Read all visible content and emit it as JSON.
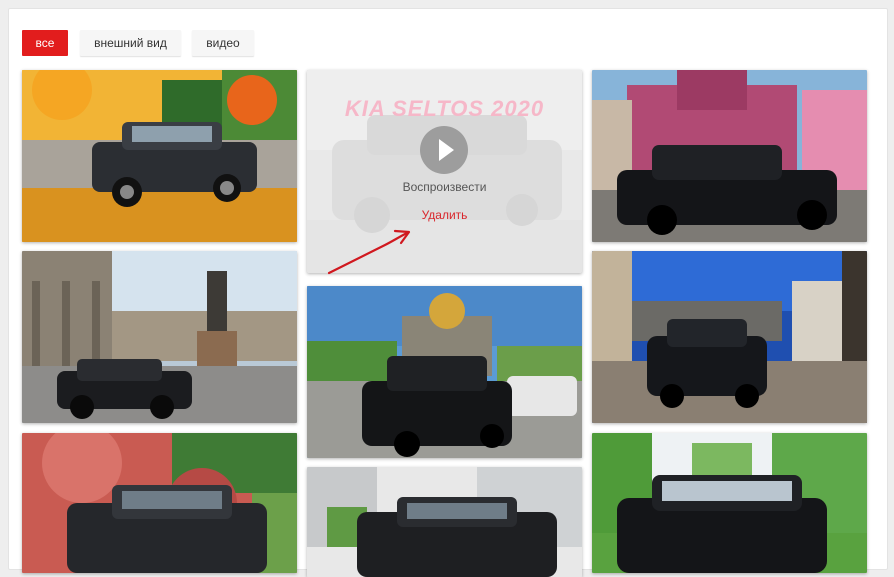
{
  "filters": {
    "all_label": "все",
    "exterior_label": "внешний вид",
    "video_label": "видео"
  },
  "video": {
    "title_overlay": "KIA SELTOS 2020",
    "play_label": "Воспроизвести",
    "delete_label": "Удалить"
  },
  "colors": {
    "accent": "#e21d1d",
    "delete_text": "#d9262c",
    "annotation_arrow": "#d0181f"
  },
  "icons": {
    "play": "play-circle-icon"
  }
}
